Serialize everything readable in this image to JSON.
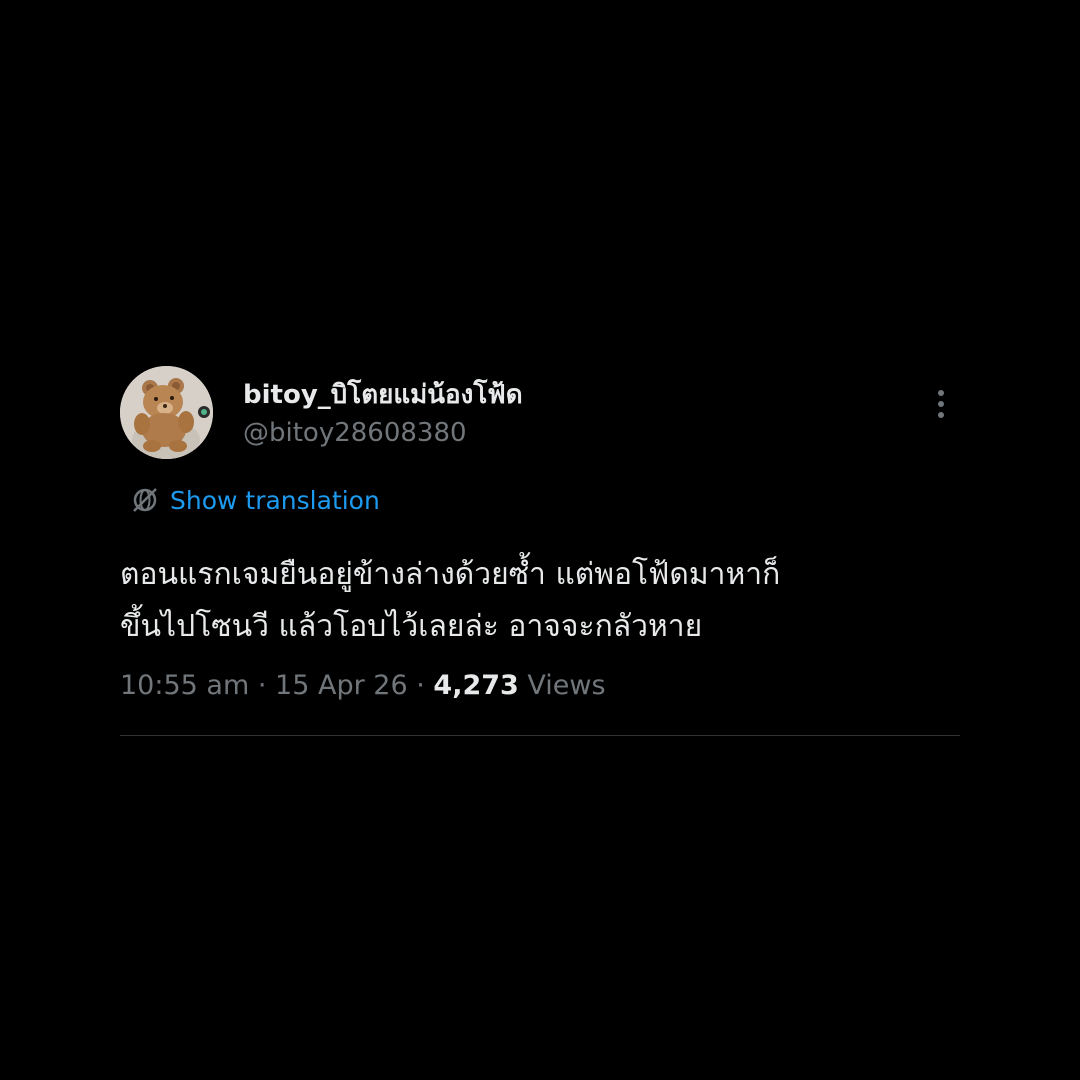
{
  "author": {
    "display_name": "bitoy_บิโตยแม่น้องโฟ้ด",
    "handle": "@bitoy28608380",
    "avatar_icon": "teddy-bear-avatar"
  },
  "more_icon": "more-vertical-icon",
  "translation": {
    "icon": "translate-globe-icon",
    "label": "Show translation"
  },
  "tweet": {
    "lines": [
      "ตอนแรกเจมยืนอยู่ข้างล่างด้วยซ้ำ แต่พอโฟ้ดมาหาก็",
      "ขึ้นไปโซนวี แล้วโอบไว้เลยล่ะ อาจจะกลัวหาย"
    ]
  },
  "meta": {
    "time": "10:55 am",
    "separator": "·",
    "date": "15 Apr 26",
    "views_count": "4,273",
    "views_label": "Views"
  },
  "colors": {
    "background": "#000000",
    "text": "#e7e9ea",
    "secondary": "#71767b",
    "link": "#1d9bf0",
    "divider": "#2f3336"
  }
}
